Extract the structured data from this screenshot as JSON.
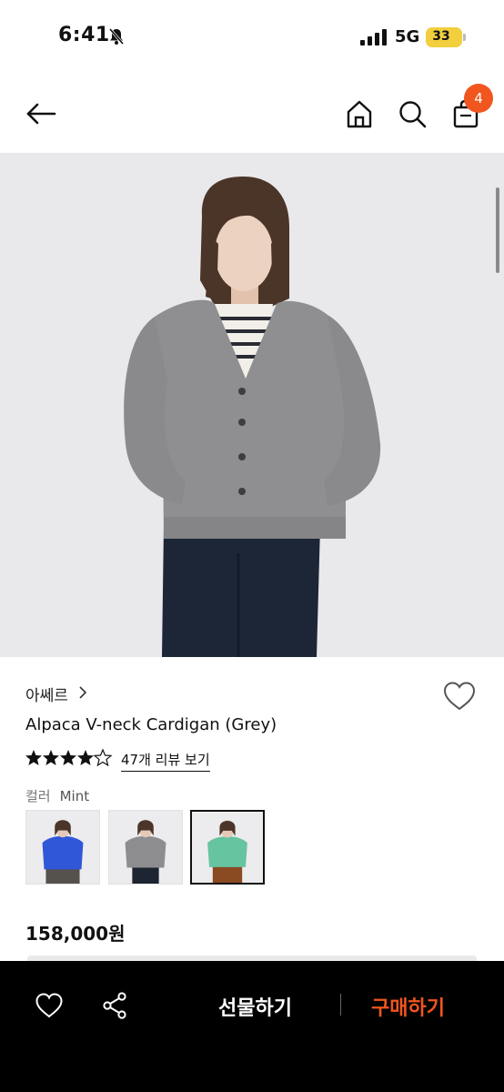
{
  "status_bar": {
    "time": "6:41",
    "network": "5G",
    "battery": "33"
  },
  "nav": {
    "cart_count": "4"
  },
  "product": {
    "brand": "아쎄르",
    "title": "Alpaca V-neck Cardigan (Grey)",
    "rating": 4.5,
    "review_link": "47개 리뷰 보기",
    "color_label": "컬러",
    "color_value": "Mint",
    "swatches": [
      "blue",
      "grey",
      "mint"
    ],
    "selected_swatch": "mint",
    "price": "158,000원"
  },
  "bottom_bar": {
    "gift_label": "선물하기",
    "buy_label": "구매하기"
  },
  "colors": {
    "accent": "#f0561e",
    "buy_text": "#f0561e",
    "bottom_bar_bg": "#000000"
  }
}
